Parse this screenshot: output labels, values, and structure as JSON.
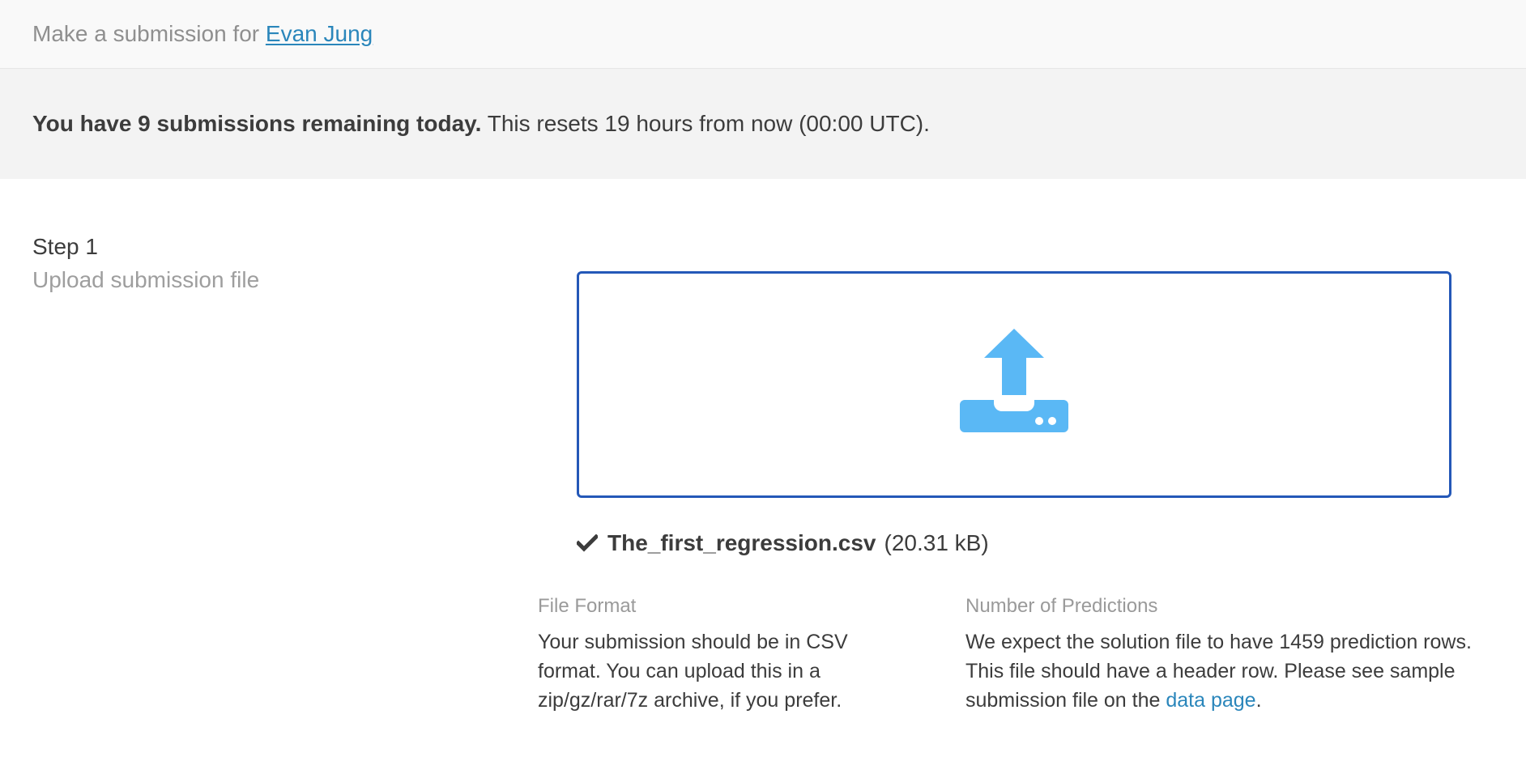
{
  "header": {
    "prefix": "Make a submission for ",
    "user_link": "Evan Jung"
  },
  "notice": {
    "strong": "You have 9 submissions remaining today.",
    "rest": " This resets 19 hours from now (00:00 UTC)."
  },
  "step": {
    "title": "Step 1",
    "subtitle": "Upload submission file"
  },
  "upload": {
    "icon": "upload-tray-icon",
    "icon_color": "#5ab8f5",
    "border_color": "#2458b8"
  },
  "file": {
    "icon": "check-icon",
    "name": "The_first_regression.csv",
    "size": "(20.31 kB)"
  },
  "file_format": {
    "title": "File Format",
    "body": "Your submission should be in CSV format. You can upload this in a zip/gz/rar/7z archive, if you prefer."
  },
  "predictions": {
    "title": "Number of Predictions",
    "body": "We expect the solution file to have 1459 prediction rows. This file should have a header row. Please see sample submission file on the ",
    "link": "data page",
    "suffix": "."
  },
  "colors": {
    "link": "#2a86bb",
    "accent_border": "#2458b8",
    "upload_icon": "#5ab8f5"
  }
}
